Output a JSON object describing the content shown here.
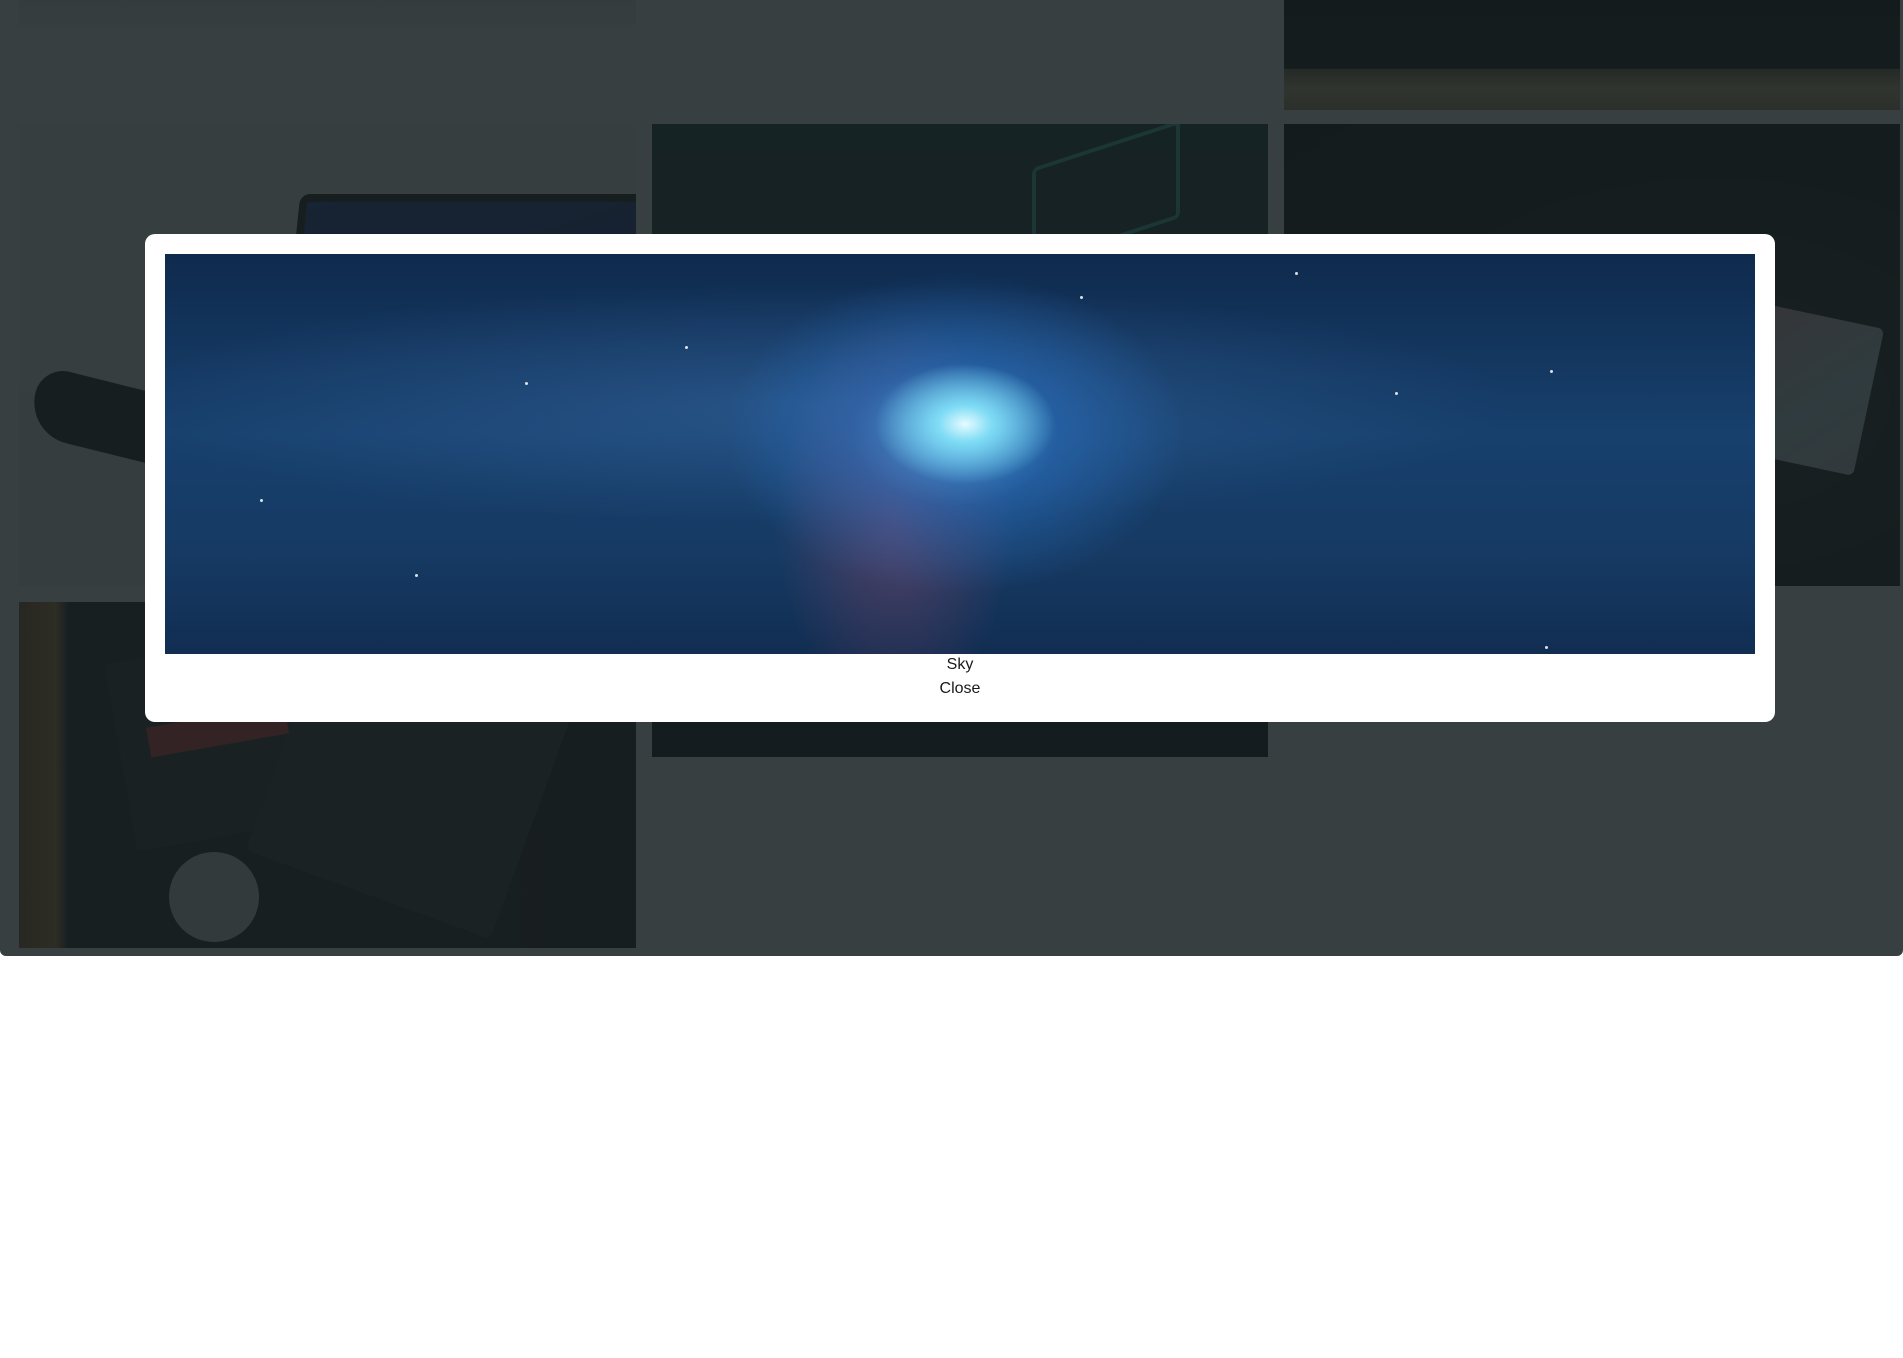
{
  "modal": {
    "image_title": "Sky",
    "close_label": "Close"
  },
  "gallery": {
    "tiles": [
      {
        "subject": "top-left-photo"
      },
      {
        "subject": "circuit-box-photo"
      },
      {
        "subject": "laptop-photo"
      },
      {
        "subject": "neon-city-photo"
      },
      {
        "subject": "banknotes-photo"
      },
      {
        "subject": "motherboard-photo"
      }
    ]
  },
  "colors": {
    "overlay": "#171f21",
    "modal_background": "#ffffff"
  }
}
